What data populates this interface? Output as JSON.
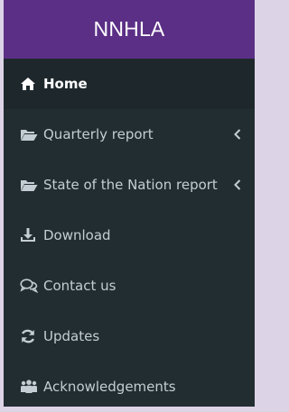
{
  "brand": {
    "title": "NNHLA"
  },
  "menu": {
    "items": [
      {
        "label": "Home",
        "icon": "home-icon",
        "active": true
      },
      {
        "label": "Quarterly report",
        "icon": "folder-open-icon",
        "expandable": true
      },
      {
        "label": "State of the Nation report",
        "icon": "folder-open-icon",
        "expandable": true
      },
      {
        "label": "Download",
        "icon": "download-icon"
      },
      {
        "label": "Contact us",
        "icon": "chat-icon"
      },
      {
        "label": "Updates",
        "icon": "refresh-icon"
      },
      {
        "label": "Acknowledgements",
        "icon": "users-icon"
      }
    ]
  },
  "colors": {
    "brand_bg": "#5b2f86",
    "sidebar_bg": "#222d32",
    "active_bg": "#1e282c",
    "text": "#c4cdd3",
    "outer_bg": "#ddd3e6"
  }
}
